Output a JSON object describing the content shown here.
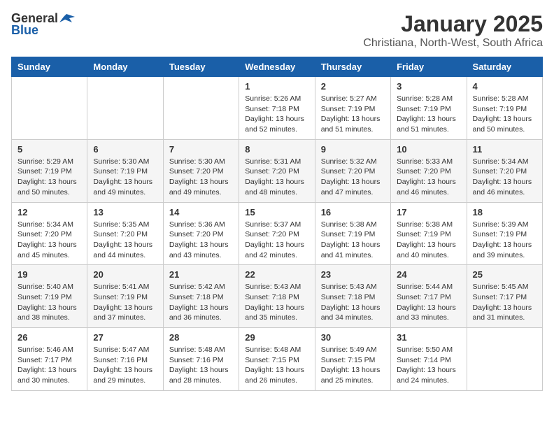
{
  "header": {
    "logo_general": "General",
    "logo_blue": "Blue",
    "title": "January 2025",
    "subtitle": "Christiana, North-West, South Africa"
  },
  "weekdays": [
    "Sunday",
    "Monday",
    "Tuesday",
    "Wednesday",
    "Thursday",
    "Friday",
    "Saturday"
  ],
  "weeks": [
    [
      {
        "day": "",
        "sunrise": "",
        "sunset": "",
        "daylight": ""
      },
      {
        "day": "",
        "sunrise": "",
        "sunset": "",
        "daylight": ""
      },
      {
        "day": "",
        "sunrise": "",
        "sunset": "",
        "daylight": ""
      },
      {
        "day": "1",
        "sunrise": "Sunrise: 5:26 AM",
        "sunset": "Sunset: 7:18 PM",
        "daylight": "Daylight: 13 hours and 52 minutes."
      },
      {
        "day": "2",
        "sunrise": "Sunrise: 5:27 AM",
        "sunset": "Sunset: 7:19 PM",
        "daylight": "Daylight: 13 hours and 51 minutes."
      },
      {
        "day": "3",
        "sunrise": "Sunrise: 5:28 AM",
        "sunset": "Sunset: 7:19 PM",
        "daylight": "Daylight: 13 hours and 51 minutes."
      },
      {
        "day": "4",
        "sunrise": "Sunrise: 5:28 AM",
        "sunset": "Sunset: 7:19 PM",
        "daylight": "Daylight: 13 hours and 50 minutes."
      }
    ],
    [
      {
        "day": "5",
        "sunrise": "Sunrise: 5:29 AM",
        "sunset": "Sunset: 7:19 PM",
        "daylight": "Daylight: 13 hours and 50 minutes."
      },
      {
        "day": "6",
        "sunrise": "Sunrise: 5:30 AM",
        "sunset": "Sunset: 7:19 PM",
        "daylight": "Daylight: 13 hours and 49 minutes."
      },
      {
        "day": "7",
        "sunrise": "Sunrise: 5:30 AM",
        "sunset": "Sunset: 7:20 PM",
        "daylight": "Daylight: 13 hours and 49 minutes."
      },
      {
        "day": "8",
        "sunrise": "Sunrise: 5:31 AM",
        "sunset": "Sunset: 7:20 PM",
        "daylight": "Daylight: 13 hours and 48 minutes."
      },
      {
        "day": "9",
        "sunrise": "Sunrise: 5:32 AM",
        "sunset": "Sunset: 7:20 PM",
        "daylight": "Daylight: 13 hours and 47 minutes."
      },
      {
        "day": "10",
        "sunrise": "Sunrise: 5:33 AM",
        "sunset": "Sunset: 7:20 PM",
        "daylight": "Daylight: 13 hours and 46 minutes."
      },
      {
        "day": "11",
        "sunrise": "Sunrise: 5:34 AM",
        "sunset": "Sunset: 7:20 PM",
        "daylight": "Daylight: 13 hours and 46 minutes."
      }
    ],
    [
      {
        "day": "12",
        "sunrise": "Sunrise: 5:34 AM",
        "sunset": "Sunset: 7:20 PM",
        "daylight": "Daylight: 13 hours and 45 minutes."
      },
      {
        "day": "13",
        "sunrise": "Sunrise: 5:35 AM",
        "sunset": "Sunset: 7:20 PM",
        "daylight": "Daylight: 13 hours and 44 minutes."
      },
      {
        "day": "14",
        "sunrise": "Sunrise: 5:36 AM",
        "sunset": "Sunset: 7:20 PM",
        "daylight": "Daylight: 13 hours and 43 minutes."
      },
      {
        "day": "15",
        "sunrise": "Sunrise: 5:37 AM",
        "sunset": "Sunset: 7:20 PM",
        "daylight": "Daylight: 13 hours and 42 minutes."
      },
      {
        "day": "16",
        "sunrise": "Sunrise: 5:38 AM",
        "sunset": "Sunset: 7:19 PM",
        "daylight": "Daylight: 13 hours and 41 minutes."
      },
      {
        "day": "17",
        "sunrise": "Sunrise: 5:38 AM",
        "sunset": "Sunset: 7:19 PM",
        "daylight": "Daylight: 13 hours and 40 minutes."
      },
      {
        "day": "18",
        "sunrise": "Sunrise: 5:39 AM",
        "sunset": "Sunset: 7:19 PM",
        "daylight": "Daylight: 13 hours and 39 minutes."
      }
    ],
    [
      {
        "day": "19",
        "sunrise": "Sunrise: 5:40 AM",
        "sunset": "Sunset: 7:19 PM",
        "daylight": "Daylight: 13 hours and 38 minutes."
      },
      {
        "day": "20",
        "sunrise": "Sunrise: 5:41 AM",
        "sunset": "Sunset: 7:19 PM",
        "daylight": "Daylight: 13 hours and 37 minutes."
      },
      {
        "day": "21",
        "sunrise": "Sunrise: 5:42 AM",
        "sunset": "Sunset: 7:18 PM",
        "daylight": "Daylight: 13 hours and 36 minutes."
      },
      {
        "day": "22",
        "sunrise": "Sunrise: 5:43 AM",
        "sunset": "Sunset: 7:18 PM",
        "daylight": "Daylight: 13 hours and 35 minutes."
      },
      {
        "day": "23",
        "sunrise": "Sunrise: 5:43 AM",
        "sunset": "Sunset: 7:18 PM",
        "daylight": "Daylight: 13 hours and 34 minutes."
      },
      {
        "day": "24",
        "sunrise": "Sunrise: 5:44 AM",
        "sunset": "Sunset: 7:17 PM",
        "daylight": "Daylight: 13 hours and 33 minutes."
      },
      {
        "day": "25",
        "sunrise": "Sunrise: 5:45 AM",
        "sunset": "Sunset: 7:17 PM",
        "daylight": "Daylight: 13 hours and 31 minutes."
      }
    ],
    [
      {
        "day": "26",
        "sunrise": "Sunrise: 5:46 AM",
        "sunset": "Sunset: 7:17 PM",
        "daylight": "Daylight: 13 hours and 30 minutes."
      },
      {
        "day": "27",
        "sunrise": "Sunrise: 5:47 AM",
        "sunset": "Sunset: 7:16 PM",
        "daylight": "Daylight: 13 hours and 29 minutes."
      },
      {
        "day": "28",
        "sunrise": "Sunrise: 5:48 AM",
        "sunset": "Sunset: 7:16 PM",
        "daylight": "Daylight: 13 hours and 28 minutes."
      },
      {
        "day": "29",
        "sunrise": "Sunrise: 5:48 AM",
        "sunset": "Sunset: 7:15 PM",
        "daylight": "Daylight: 13 hours and 26 minutes."
      },
      {
        "day": "30",
        "sunrise": "Sunrise: 5:49 AM",
        "sunset": "Sunset: 7:15 PM",
        "daylight": "Daylight: 13 hours and 25 minutes."
      },
      {
        "day": "31",
        "sunrise": "Sunrise: 5:50 AM",
        "sunset": "Sunset: 7:14 PM",
        "daylight": "Daylight: 13 hours and 24 minutes."
      },
      {
        "day": "",
        "sunrise": "",
        "sunset": "",
        "daylight": ""
      }
    ]
  ]
}
